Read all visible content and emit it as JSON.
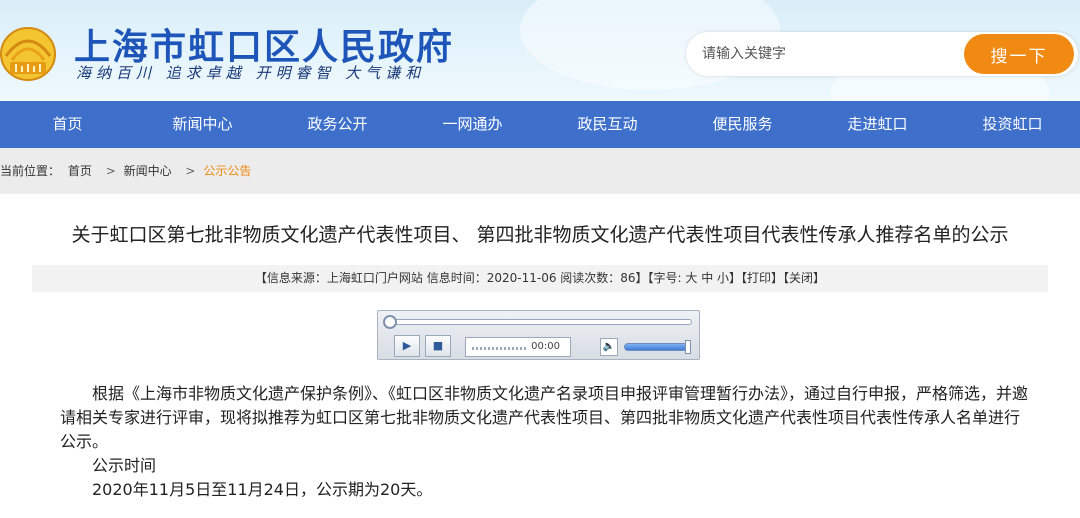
{
  "header": {
    "site_title": "上海市虹口区人民政府",
    "motto": "海纳百川 追求卓越 开明睿智 大气谦和",
    "search_placeholder": "请输入关键字",
    "search_button": "搜一下"
  },
  "nav": [
    "首页",
    "新闻中心",
    "政务公开",
    "一网通办",
    "政民互动",
    "便民服务",
    "走进虹口",
    "投资虹口"
  ],
  "breadcrumb": {
    "label": "当前位置：",
    "items": [
      "首页",
      "新闻中心",
      "公示公告"
    ],
    "separator": ">"
  },
  "article": {
    "title": "关于虹口区第七批非物质文化遗产代表性项目、 第四批非物质文化遗产代表性项目代表性传承人推荐名单的公示",
    "meta": "【信息来源：上海虹口门户网站  信息时间：2020-11-06  阅读次数：86】【字号: 大 中 小】【打印】【关闭】",
    "player_time": "00:00",
    "paragraphs": [
      "根据《上海市非物质文化遗产保护条例》、《虹口区非物质文化遗产名录项目申报评审管理暂行办法》，通过自行申报，严格筛选，并邀请相关专家进行评审，现将拟推荐为虹口区第七批非物质文化遗产代表性项目、第四批非物质文化遗产代表性项目代表性传承人名单进行公示。",
      "公示时间",
      "2020年11月5日至11月24日，公示期为20天。"
    ]
  },
  "colors": {
    "nav_bg": "#3d6fcb",
    "accent": "#f08a13",
    "title_blue": "#1d55b8"
  }
}
